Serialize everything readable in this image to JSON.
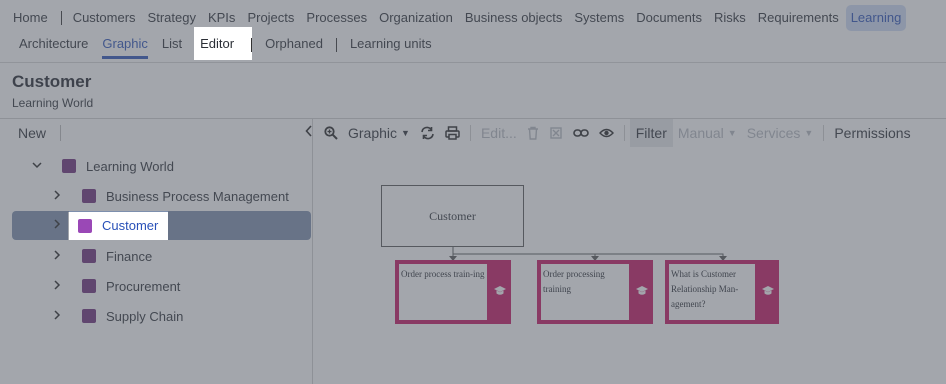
{
  "top_nav": {
    "items": [
      "Home",
      "Customers",
      "Strategy",
      "KPIs",
      "Projects",
      "Processes",
      "Organization",
      "Business objects",
      "Systems",
      "Documents",
      "Risks",
      "Requirements",
      "Learning"
    ],
    "active": "Learning"
  },
  "sub_nav": {
    "items": [
      "Architecture",
      "Graphic",
      "List",
      "Editor",
      "Orphaned",
      "Learning units"
    ],
    "selected": "Graphic",
    "highlighted": "Editor"
  },
  "page": {
    "title": "Customer",
    "subtitle": "Learning World"
  },
  "left_toolbar": {
    "new_label": "New",
    "collapse_icon": "chevron-left-icon"
  },
  "tree": {
    "items": [
      {
        "label": "Learning World",
        "level": 0,
        "expanded": true
      },
      {
        "label": "Business Process Management",
        "level": 1,
        "expanded": false
      },
      {
        "label": "Customer",
        "level": 1,
        "expanded": false,
        "selected": true
      },
      {
        "label": "Finance",
        "level": 1,
        "expanded": false
      },
      {
        "label": "Procurement",
        "level": 1,
        "expanded": false
      },
      {
        "label": "Supply Chain",
        "level": 1,
        "expanded": false
      }
    ],
    "item_color": "#6a2a78"
  },
  "right_toolbar": {
    "graphic_label": "Graphic",
    "edit_label": "Edit...",
    "filter_label": "Filter",
    "manual_label": "Manual",
    "services_label": "Services",
    "permissions_label": "Permissions"
  },
  "diagram": {
    "parent": "Customer",
    "children": [
      "Order process train-ing",
      "Order processing training",
      "What is Customer Relationship Man-agement?"
    ],
    "child_color": "#c5105f"
  }
}
